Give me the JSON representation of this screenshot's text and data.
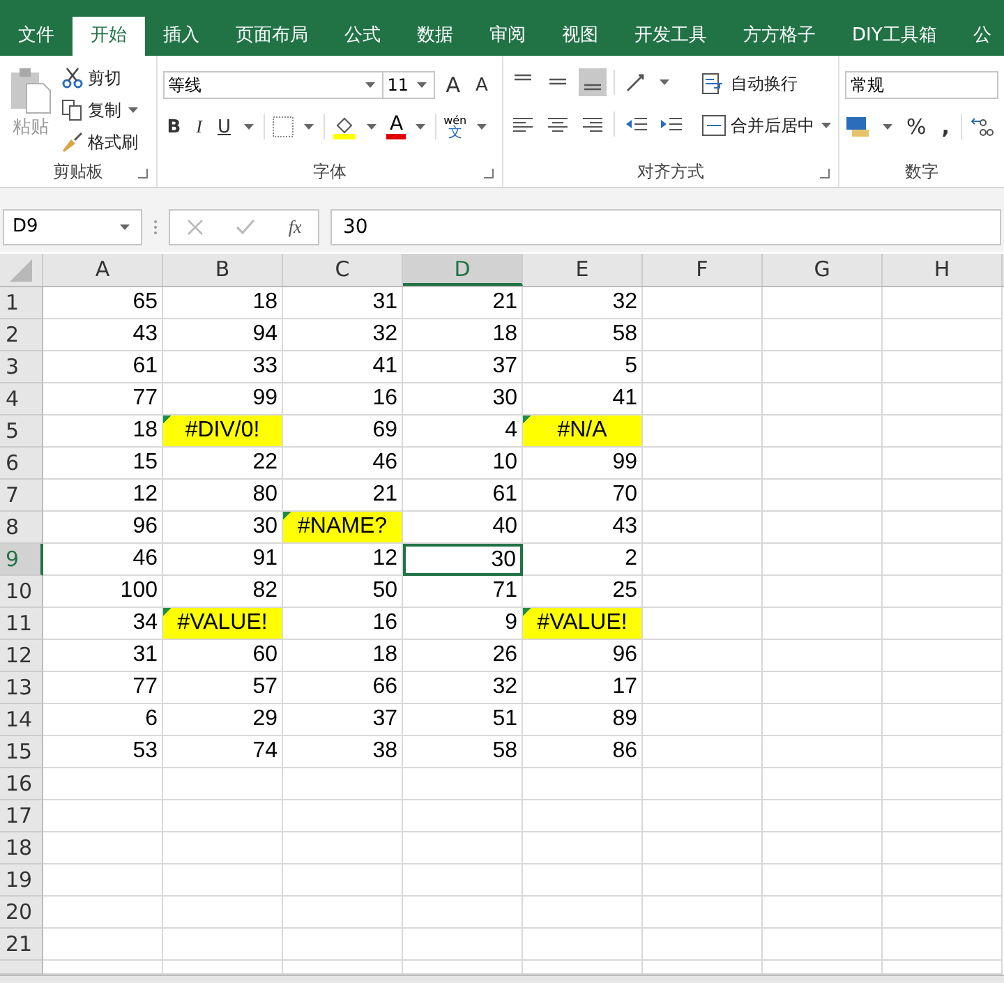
{
  "ribbon_tabs": [
    {
      "label": "文件",
      "selected": false
    },
    {
      "label": "开始",
      "selected": true
    },
    {
      "label": "插入",
      "selected": false
    },
    {
      "label": "页面布局",
      "selected": false
    },
    {
      "label": "公式",
      "selected": false
    },
    {
      "label": "数据",
      "selected": false
    },
    {
      "label": "审阅",
      "selected": false
    },
    {
      "label": "视图",
      "selected": false
    },
    {
      "label": "开发工具",
      "selected": false
    },
    {
      "label": "方方格子",
      "selected": false
    },
    {
      "label": "DIY工具箱",
      "selected": false
    },
    {
      "label": "公",
      "selected": false
    }
  ],
  "clipboard": {
    "paste": "粘贴",
    "cut": "剪切",
    "copy": "复制",
    "format_painter": "格式刷",
    "label": "剪贴板"
  },
  "font": {
    "name": "等线",
    "size": "11",
    "grow": "A",
    "shrink": "A",
    "bold": "B",
    "italic": "I",
    "underline": "U",
    "font_color": "A",
    "phonetic": "wén",
    "phonetic_char": "文",
    "label": "字体"
  },
  "alignment": {
    "wrap": "自动换行",
    "merge": "合并后居中",
    "label": "对齐方式"
  },
  "number": {
    "format": "常规",
    "percent": "%",
    "comma": ",",
    "label": "数字"
  },
  "formula_bar": {
    "name_box": "D9",
    "function": "fx",
    "value": "30"
  },
  "columns": [
    {
      "label": "A",
      "selected": false
    },
    {
      "label": "B",
      "selected": false
    },
    {
      "label": "C",
      "selected": false
    },
    {
      "label": "D",
      "selected": true
    },
    {
      "label": "E",
      "selected": false
    },
    {
      "label": "F",
      "selected": false
    },
    {
      "label": "G",
      "selected": false
    },
    {
      "label": "H",
      "selected": false
    }
  ],
  "rows": [
    {
      "number": "1",
      "selected": false,
      "cells": [
        "65",
        "18",
        "31",
        "21",
        "32"
      ]
    },
    {
      "number": "2",
      "selected": false,
      "cells": [
        "43",
        "94",
        "32",
        "18",
        "58"
      ]
    },
    {
      "number": "3",
      "selected": false,
      "cells": [
        "61",
        "33",
        "41",
        "37",
        "5"
      ]
    },
    {
      "number": "4",
      "selected": false,
      "cells": [
        "77",
        "99",
        "16",
        "30",
        "41"
      ]
    },
    {
      "number": "5",
      "selected": false,
      "cells": [
        "18",
        {
          "text": "#DIV/0!",
          "highlight": true,
          "flag": true,
          "selected": false
        },
        "69",
        "4",
        {
          "text": "#N/A",
          "highlight": true,
          "flag": true,
          "selected": false
        }
      ]
    },
    {
      "number": "6",
      "selected": false,
      "cells": [
        "15",
        "22",
        "46",
        "10",
        "99"
      ]
    },
    {
      "number": "7",
      "selected": false,
      "cells": [
        "12",
        "80",
        "21",
        "61",
        "70"
      ]
    },
    {
      "number": "8",
      "selected": false,
      "cells": [
        "96",
        "30",
        {
          "text": "#NAME?",
          "highlight": true,
          "flag": true,
          "selected": false
        },
        "40",
        "43"
      ]
    },
    {
      "number": "9",
      "selected": true,
      "cells": [
        "46",
        "91",
        "12",
        {
          "text": "30",
          "highlight": false,
          "flag": false,
          "selected": true
        },
        "2"
      ]
    },
    {
      "number": "10",
      "selected": false,
      "cells": [
        "100",
        "82",
        "50",
        "71",
        "25"
      ]
    },
    {
      "number": "11",
      "selected": false,
      "cells": [
        "34",
        {
          "text": "#VALUE!",
          "highlight": true,
          "flag": true,
          "selected": false
        },
        "16",
        "9",
        {
          "text": "#VALUE!",
          "highlight": true,
          "flag": true,
          "selected": false
        }
      ]
    },
    {
      "number": "12",
      "selected": false,
      "cells": [
        "31",
        "60",
        "18",
        "26",
        "96"
      ]
    },
    {
      "number": "13",
      "selected": false,
      "cells": [
        "77",
        "57",
        "66",
        "32",
        "17"
      ]
    },
    {
      "number": "14",
      "selected": false,
      "cells": [
        "6",
        "29",
        "37",
        "51",
        "89"
      ]
    },
    {
      "number": "15",
      "selected": false,
      "cells": [
        "53",
        "74",
        "38",
        "58",
        "86"
      ]
    },
    {
      "number": "16",
      "selected": false,
      "cells": []
    },
    {
      "number": "17",
      "selected": false,
      "cells": []
    },
    {
      "number": "18",
      "selected": false,
      "cells": []
    },
    {
      "number": "19",
      "selected": false,
      "cells": []
    },
    {
      "number": "20",
      "selected": false,
      "cells": []
    },
    {
      "number": "21",
      "selected": false,
      "cells": []
    }
  ]
}
